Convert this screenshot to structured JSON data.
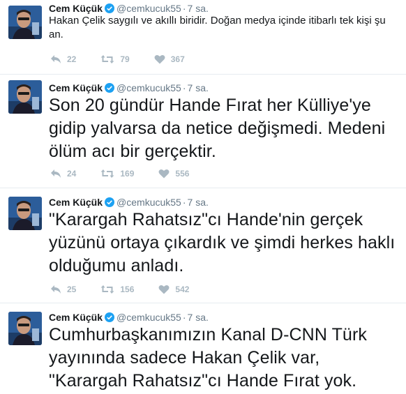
{
  "tweets": [
    {
      "name": "Cem Küçük",
      "handle": "@cemkucuk55",
      "separator": "·",
      "time": "7 sa.",
      "text": "Hakan Çelik saygılı ve akıllı biridir. Doğan medya içinde itibarlı tek kişi şu an.",
      "replies": "22",
      "retweets": "79",
      "likes": "367"
    },
    {
      "name": "Cem Küçük",
      "handle": "@cemkucuk55",
      "separator": "·",
      "time": "7 sa.",
      "text": "Son 20 gündür Hande Fırat her Külliye'ye gidip yalvarsa da netice değişmedi. Medeni ölüm acı bir gerçektir.",
      "replies": "24",
      "retweets": "169",
      "likes": "556"
    },
    {
      "name": "Cem Küçük",
      "handle": "@cemkucuk55",
      "separator": "·",
      "time": "7 sa.",
      "text": "\"Karargah Rahatsız\"cı Hande'nin gerçek yüzünü ortaya çıkardık ve şimdi herkes haklı olduğumu anladı.",
      "replies": "25",
      "retweets": "156",
      "likes": "542"
    },
    {
      "name": "Cem Küçük",
      "handle": "@cemkucuk55",
      "separator": "·",
      "time": "7 sa.",
      "text": "Cumhurbaşkanımızın Kanal D-CNN Türk yayınında sadece Hakan Çelik var, \"Karargah Rahatsız\"cı Hande Fırat yok."
    }
  ],
  "icons": {
    "reply": "reply-icon",
    "retweet": "retweet-icon",
    "like": "heart-icon",
    "verified": "verified-badge-icon"
  },
  "colors": {
    "text": "#14171a",
    "muted": "#657786",
    "action": "#aab8c2",
    "verified": "#1da1f2",
    "divider": "#e6ecf0"
  }
}
